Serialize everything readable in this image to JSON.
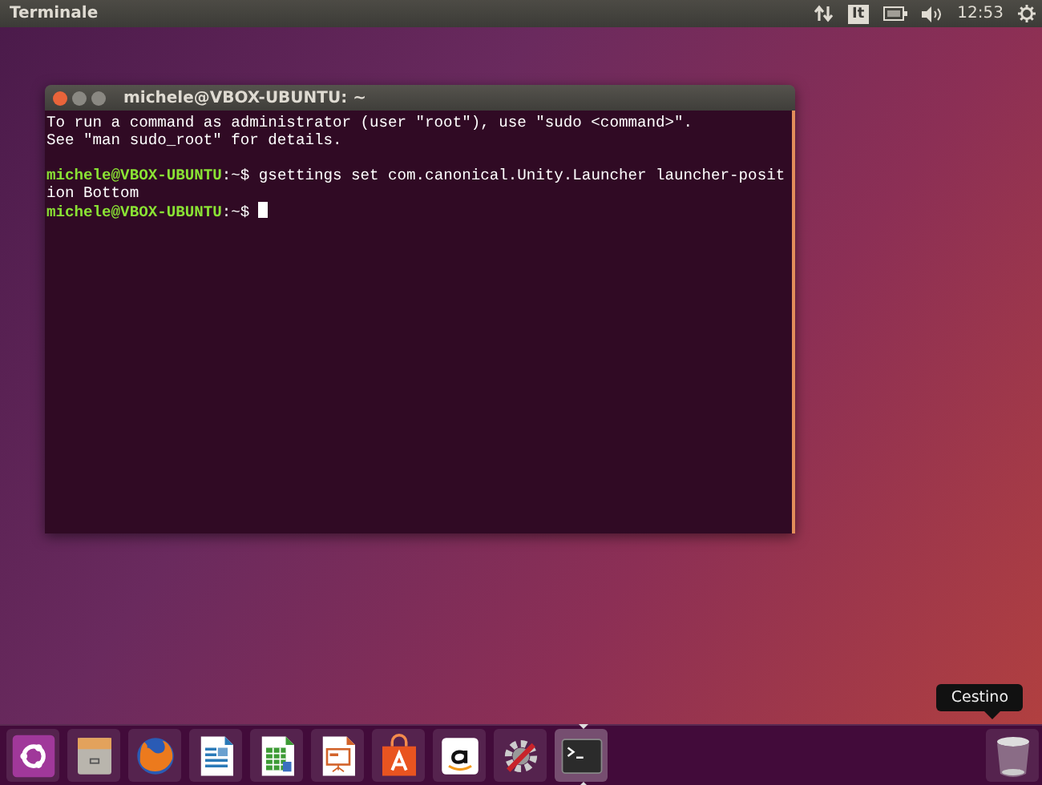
{
  "top_panel": {
    "app_title": "Terminale",
    "keyboard_layout": "It",
    "clock": "12:53"
  },
  "terminal": {
    "title": "michele@VBOX-UBUNTU: ~",
    "lines": [
      {
        "kind": "output",
        "text": "To run a command as administrator (user \"root\"), use \"sudo <command>\"."
      },
      {
        "kind": "output",
        "text": "See \"man sudo_root\" for details."
      },
      {
        "kind": "blank"
      },
      {
        "kind": "prompt",
        "user": "michele@VBOX-UBUNTU",
        "path": ":~$",
        "command": "gsettings set com.canonical.Unity.Launcher launcher-posit"
      },
      {
        "kind": "output",
        "text": "ion Bottom"
      },
      {
        "kind": "prompt",
        "user": "michele@VBOX-UBUNTU",
        "path": ":~$",
        "cursor": true
      }
    ]
  },
  "launcher": {
    "items": [
      {
        "kind": "dash",
        "active": false
      },
      {
        "kind": "files",
        "active": false
      },
      {
        "kind": "browser",
        "active": false
      },
      {
        "kind": "writer",
        "active": false
      },
      {
        "kind": "calc",
        "active": false
      },
      {
        "kind": "impress",
        "active": false
      },
      {
        "kind": "software",
        "active": false
      },
      {
        "kind": "amazon",
        "active": false
      },
      {
        "kind": "settings",
        "active": false
      },
      {
        "kind": "terminal",
        "active": true
      }
    ],
    "trash": {
      "tooltip": "Cestino"
    }
  }
}
